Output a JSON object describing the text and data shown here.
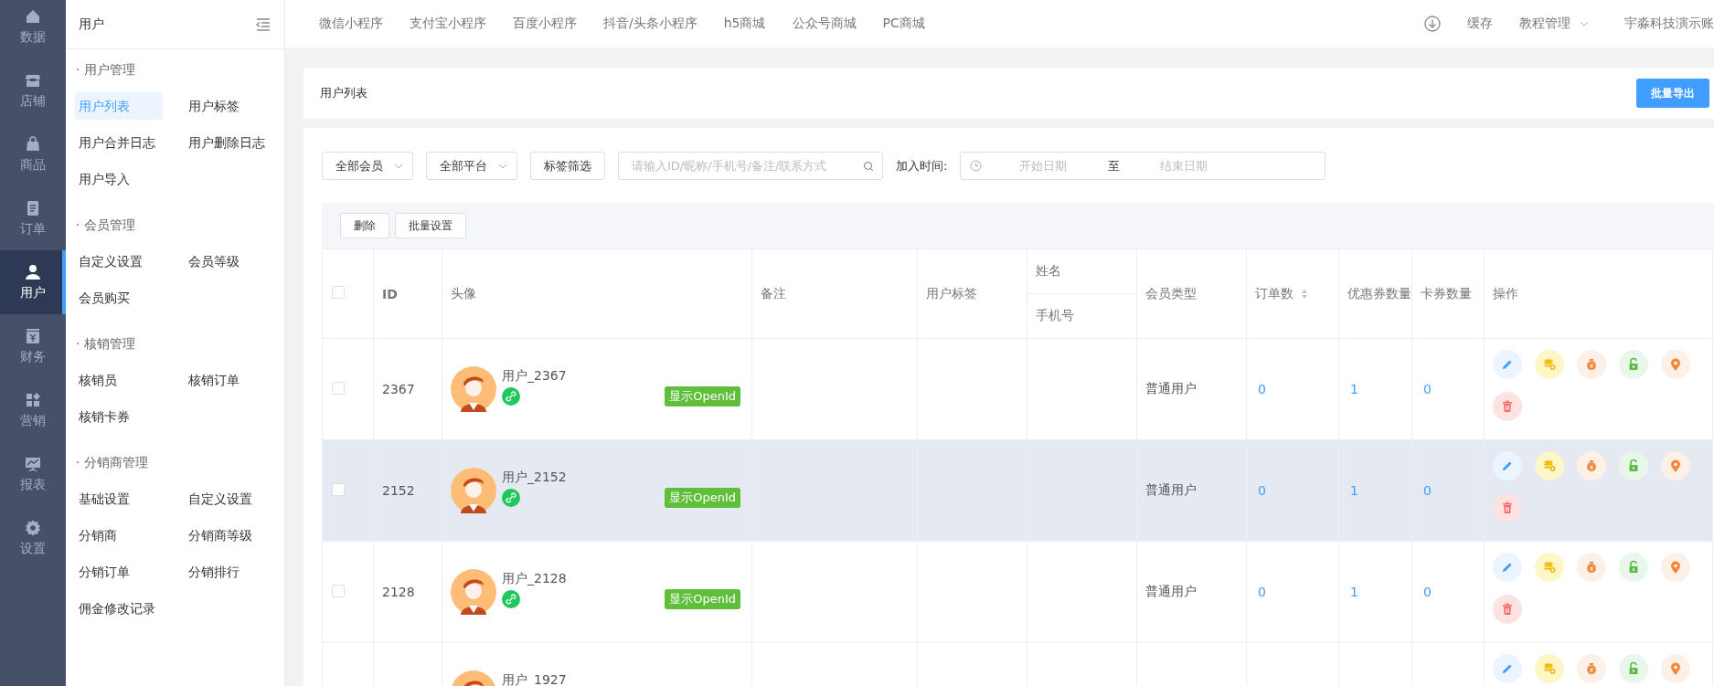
{
  "rail": {
    "items": [
      {
        "label": "数据",
        "selected": false
      },
      {
        "label": "店铺",
        "selected": false
      },
      {
        "label": "商品",
        "selected": false
      },
      {
        "label": "订单",
        "selected": false
      },
      {
        "label": "用户",
        "selected": true
      },
      {
        "label": "财务",
        "selected": false
      },
      {
        "label": "营销",
        "selected": false
      },
      {
        "label": "报表",
        "selected": false
      },
      {
        "label": "设置",
        "selected": false
      }
    ]
  },
  "subnav": {
    "title": "用户",
    "groups": [
      {
        "title": "· 用户管理",
        "items": [
          {
            "label": "用户列表",
            "selected": true
          },
          {
            "label": "用户标签",
            "selected": false
          },
          {
            "label": "用户合并日志",
            "selected": false
          },
          {
            "label": "用户删除日志",
            "selected": false
          },
          {
            "label": "用户导入",
            "selected": false
          }
        ]
      },
      {
        "title": "· 会员管理",
        "items": [
          {
            "label": "自定义设置",
            "selected": false
          },
          {
            "label": "会员等级",
            "selected": false
          },
          {
            "label": "会员购买",
            "selected": false
          }
        ]
      },
      {
        "title": "· 核销管理",
        "items": [
          {
            "label": "核销员",
            "selected": false
          },
          {
            "label": "核销订单",
            "selected": false
          },
          {
            "label": "核销卡券",
            "selected": false
          }
        ]
      },
      {
        "title": "· 分销商管理",
        "items": [
          {
            "label": "基础设置",
            "selected": false
          },
          {
            "label": "自定义设置",
            "selected": false
          },
          {
            "label": "分销商",
            "selected": false
          },
          {
            "label": "分销商等级",
            "selected": false
          },
          {
            "label": "分销订单",
            "selected": false
          },
          {
            "label": "分销排行",
            "selected": false
          },
          {
            "label": "佣金修改记录",
            "selected": false
          }
        ]
      }
    ]
  },
  "topbar": {
    "links": [
      "微信小程序",
      "支付宝小程序",
      "百度小程序",
      "抖音/头条小程序",
      "h5商城",
      "公众号商城",
      "PC商城"
    ],
    "cache": "缓存",
    "tutorial": "教程管理",
    "account": "宇淼科技演示账"
  },
  "page_header": {
    "title": "用户列表",
    "export_button": "批量导出"
  },
  "filters": {
    "member_select": "全部会员",
    "platform_select": "全部平台",
    "tag_filter_button": "标签筛选",
    "search": {
      "placeholder": "请输入ID/昵称/手机号/备注/联系方式"
    },
    "date_label": "加入时间:",
    "date_range": {
      "start_placeholder": "开始日期",
      "separator": "至",
      "end_placeholder": "结束日期"
    }
  },
  "toolbar": {
    "buttons": [
      "删除",
      "批量设置"
    ]
  },
  "table": {
    "header_checked": false,
    "columns": [
      {
        "label": "ID",
        "sortable": false
      },
      {
        "label": "头像",
        "sortable": false
      },
      {
        "label": "备注",
        "sortable": false
      },
      {
        "label": "用户标签",
        "sortable": false
      },
      {
        "label": "姓名",
        "sub_label": "手机号",
        "sortable": false
      },
      {
        "label": "会员类型",
        "sortable": false
      },
      {
        "label": "订单数",
        "sortable": true
      },
      {
        "label": "优惠券数量",
        "sortable": false
      },
      {
        "label": "卡券数量",
        "sortable": false
      },
      {
        "label": "操作",
        "sortable": false
      }
    ],
    "rows": [
      {
        "checked": false,
        "highlighted": false,
        "id": "2367",
        "name": "用户_2367",
        "openid_button": "显示OpenId",
        "member_type": "普通用户",
        "orders": "0",
        "coupons": "1",
        "cards": "0"
      },
      {
        "checked": false,
        "highlighted": true,
        "id": "2152",
        "name": "用户_2152",
        "openid_button": "显示OpenId",
        "member_type": "普通用户",
        "orders": "0",
        "coupons": "1",
        "cards": "0"
      },
      {
        "checked": false,
        "highlighted": false,
        "id": "2128",
        "name": "用户_2128",
        "openid_button": "显示OpenId",
        "member_type": "普通用户",
        "orders": "0",
        "coupons": "1",
        "cards": "0"
      },
      {
        "highlighted": false,
        "name": "用户_1927"
      }
    ]
  }
}
